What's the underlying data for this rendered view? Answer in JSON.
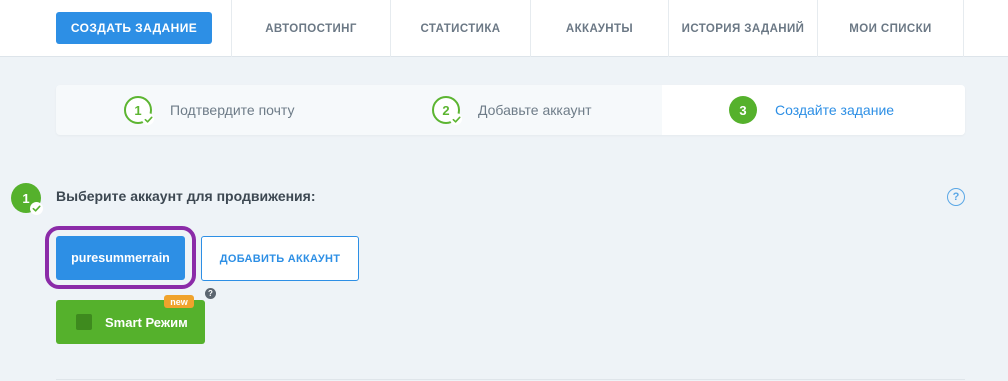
{
  "nav": {
    "create_label": "СОЗДАТЬ ЗАДАНИЕ",
    "tabs": [
      {
        "label": "АВТОПОСТИНГ"
      },
      {
        "label": "СТАТИСТИКА"
      },
      {
        "label": "АККАУНТЫ"
      },
      {
        "label": "ИСТОРИЯ ЗАДАНИЙ"
      },
      {
        "label": "МОИ СПИСКИ"
      }
    ]
  },
  "stepper": {
    "steps": [
      {
        "number": "1",
        "label": "Подтвердите почту",
        "state": "done"
      },
      {
        "number": "2",
        "label": "Добавьте аккаунт",
        "state": "done"
      },
      {
        "number": "3",
        "label": "Создайте задание",
        "state": "active"
      }
    ]
  },
  "section": {
    "number": "1",
    "title": "Выберите аккаунт для продвижения:",
    "help_symbol": "?",
    "account_label": "puresummerrain",
    "add_account_label": "ДОБАВИТЬ АККАУНТ",
    "smart_label": "Smart Режим",
    "new_badge": "new",
    "smart_help_symbol": "?"
  },
  "colors": {
    "primary_blue": "#2d8fe5",
    "green": "#55b12c",
    "highlight_purple": "#8b2ba8",
    "badge_orange": "#f0a32c"
  }
}
